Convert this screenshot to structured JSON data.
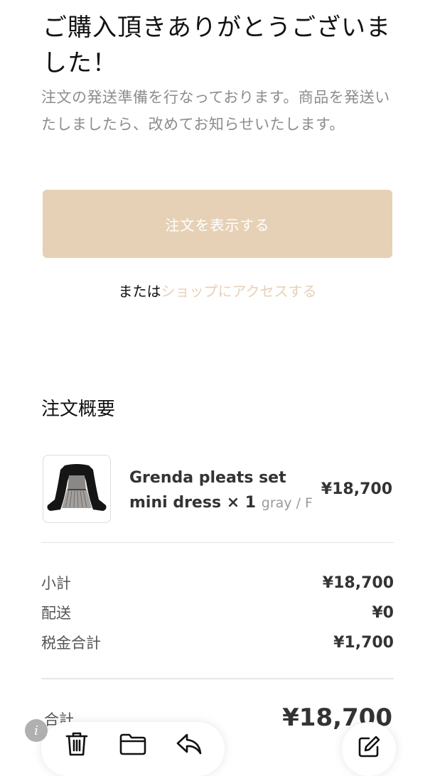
{
  "confirmation": {
    "title": "ご購入頂きありがとうございました！",
    "message": "注文の発送準備を行なっております。商品を発送いたしましたら、改めてお知らせいたします。",
    "view_order_button": "注文を表示する",
    "or_text": "または",
    "shop_link": "ショップにアクセスする"
  },
  "order_summary": {
    "heading": "注文概要",
    "items": [
      {
        "name": "Grenda pleats set mini dress × 1",
        "variant": "gray / F",
        "price": "¥18,700"
      }
    ],
    "costs": [
      {
        "label": "小計",
        "value": "¥18,700"
      },
      {
        "label": "配送",
        "value": "¥0"
      },
      {
        "label": "税金合計",
        "value": "¥1,700"
      }
    ],
    "total_label": "合計",
    "total_value": "¥18,700"
  },
  "toolbar": {
    "icons": [
      "trash-icon",
      "folder-icon",
      "reply-icon",
      "compose-icon",
      "info-icon"
    ],
    "info_glyph": "i"
  },
  "colors": {
    "accent": "#e6d1b7",
    "muted_text": "#8c8c8c"
  }
}
